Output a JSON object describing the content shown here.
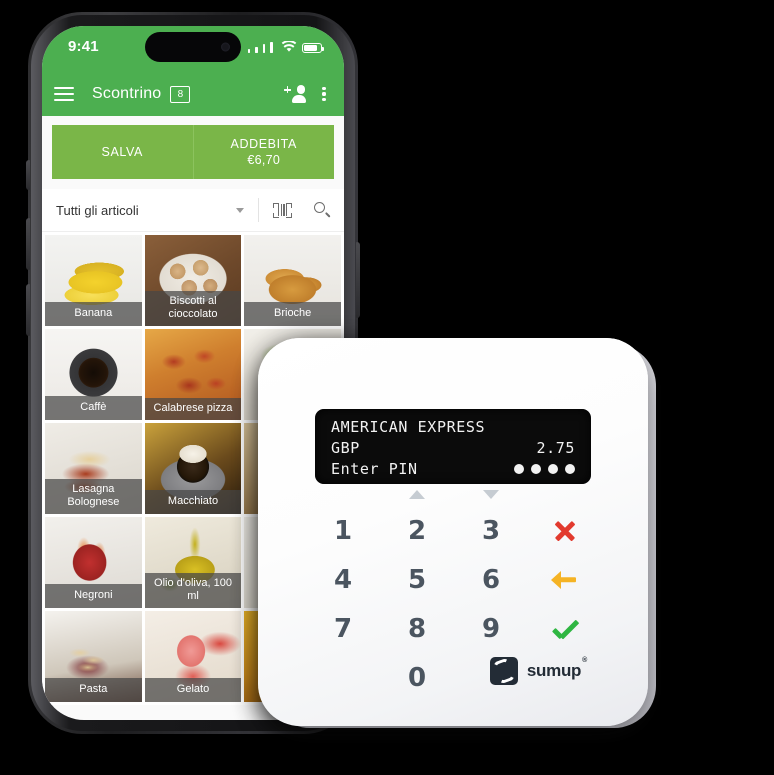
{
  "phone": {
    "status_bar": {
      "time": "9:41",
      "signal_icon": "cellular-signal-icon",
      "wifi_icon": "wifi-icon",
      "battery_icon": "battery-icon"
    },
    "app_bar": {
      "menu_icon": "hamburger-menu-icon",
      "title": "Scontrino",
      "cart_badge": "8",
      "add_customer_icon": "add-person-icon",
      "overflow_icon": "more-vertical-icon"
    },
    "actions": {
      "save_label": "SALVA",
      "charge_label": "ADDEBITA",
      "charge_amount": "€6,70"
    },
    "filter": {
      "selected": "Tutti gli articoli",
      "dropdown_icon": "chevron-down-icon",
      "barcode_icon": "barcode-scanner-icon",
      "search_icon": "search-icon"
    },
    "products": [
      {
        "label": "Banana",
        "photo": "p-banana"
      },
      {
        "label": "Biscotti al cioccolato",
        "photo": "p-biscotti"
      },
      {
        "label": "Brioche",
        "photo": "p-brioche"
      },
      {
        "label": "Caffè",
        "photo": "p-caffe"
      },
      {
        "label": "Calabrese pizza",
        "photo": "p-calabrese"
      },
      {
        "label": "",
        "photo": "p-pollo"
      },
      {
        "label": "Lasagna Bolognese",
        "photo": "p-lasagna"
      },
      {
        "label": "Macchiato",
        "photo": "p-macchiato"
      },
      {
        "label": "",
        "photo": "p-tiramisu"
      },
      {
        "label": "Negroni",
        "photo": "p-negroni"
      },
      {
        "label": "Olio d'oliva, 100 ml",
        "photo": "p-olio"
      },
      {
        "label": "",
        "photo": "p-insalata"
      },
      {
        "label": "Pasta",
        "photo": "p-pasta"
      },
      {
        "label": "Gelato",
        "photo": "p-gelato"
      },
      {
        "label": "",
        "photo": "p-birra"
      }
    ]
  },
  "reader": {
    "display": {
      "card_scheme": "AMERICAN EXPRESS",
      "currency": "GBP",
      "amount": "2.75",
      "prompt": "Enter PIN",
      "pin_dots": 4
    },
    "keypad": {
      "keys": [
        "1",
        "2",
        "3",
        "4",
        "5",
        "6",
        "7",
        "8",
        "9",
        "0"
      ],
      "scroll_up_icon": "triangle-up-icon",
      "scroll_down_icon": "triangle-down-icon",
      "cancel_icon": "cancel-x-icon",
      "backspace_icon": "backspace-arrow-icon",
      "confirm_icon": "confirm-check-icon"
    },
    "brand": {
      "logo_icon": "sumup-logo-icon",
      "name": "sumup",
      "registered": "®"
    }
  },
  "colors": {
    "header_green": "#4caf50",
    "button_green": "#7ab648",
    "cancel_red": "#e23a2e",
    "backspace_yellow": "#f5b324",
    "confirm_green": "#2fb642"
  }
}
